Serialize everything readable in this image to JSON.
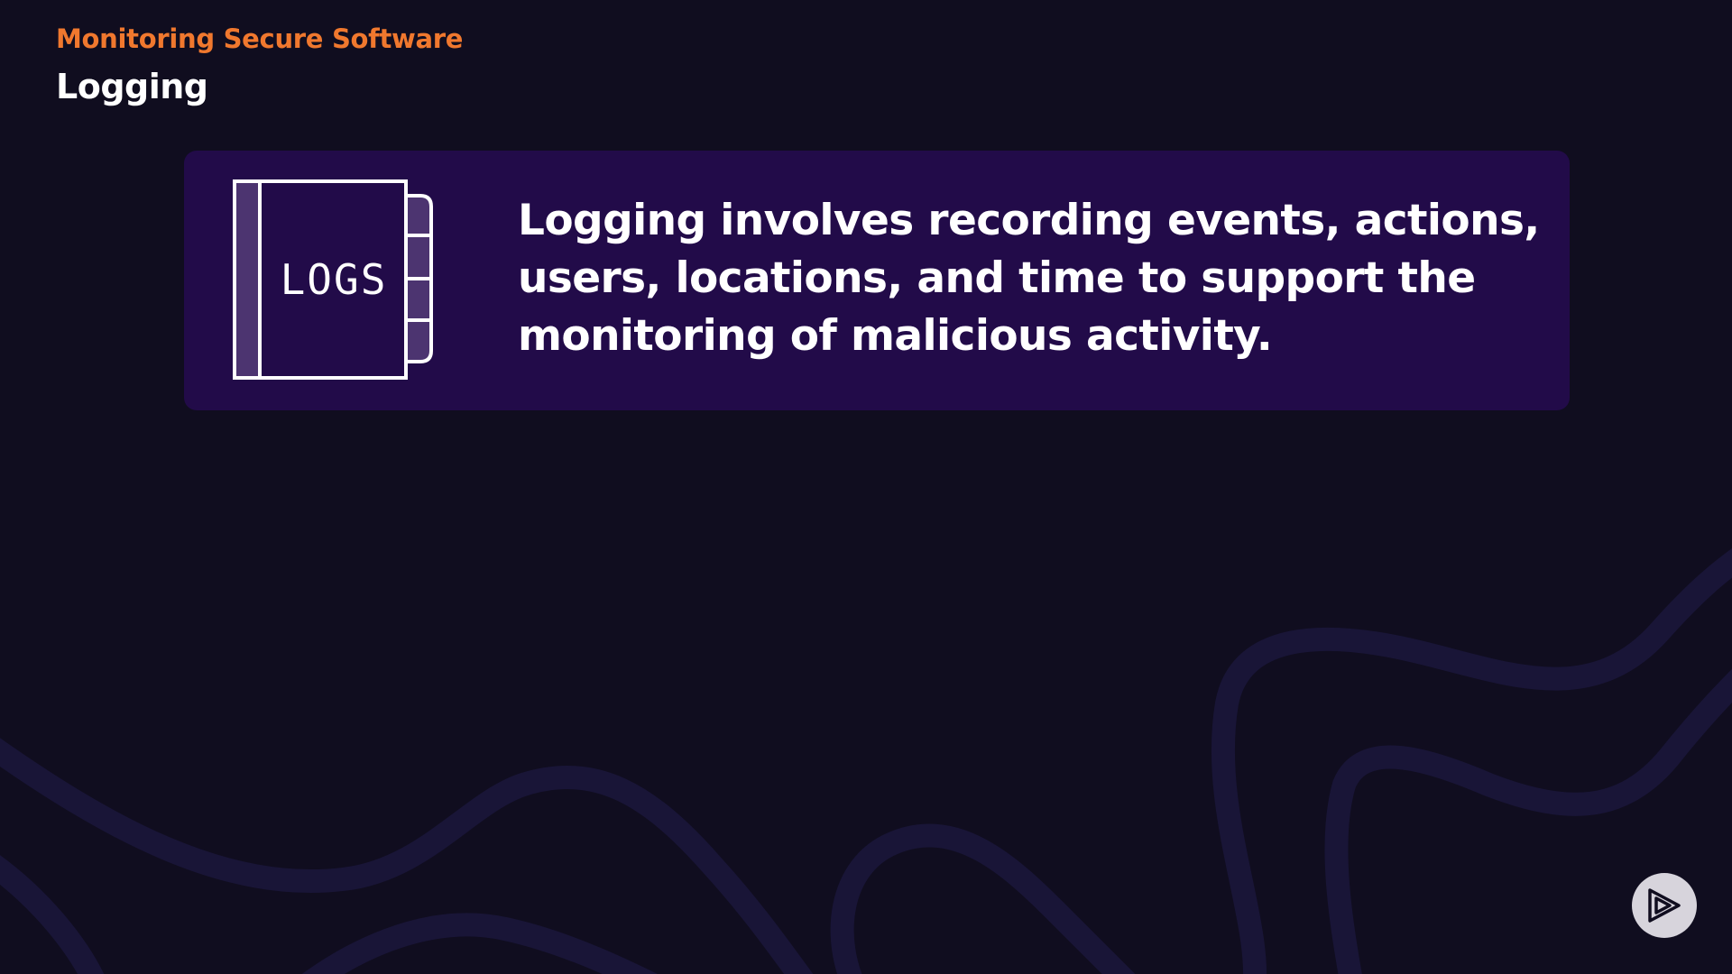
{
  "header": {
    "course_title": "Monitoring Secure Software",
    "section_title": "Logging"
  },
  "callout": {
    "icon": "logs-book-icon",
    "icon_label": "LOGS",
    "text": "Logging involves recording events, actions, users, locations, and time to support the monitoring of malicious activity."
  },
  "player": {
    "icon": "play-logo-icon"
  },
  "colors": {
    "background": "#100d1f",
    "accent": "#f0782e",
    "callout_background": "#220b49",
    "wave": "#191537"
  }
}
